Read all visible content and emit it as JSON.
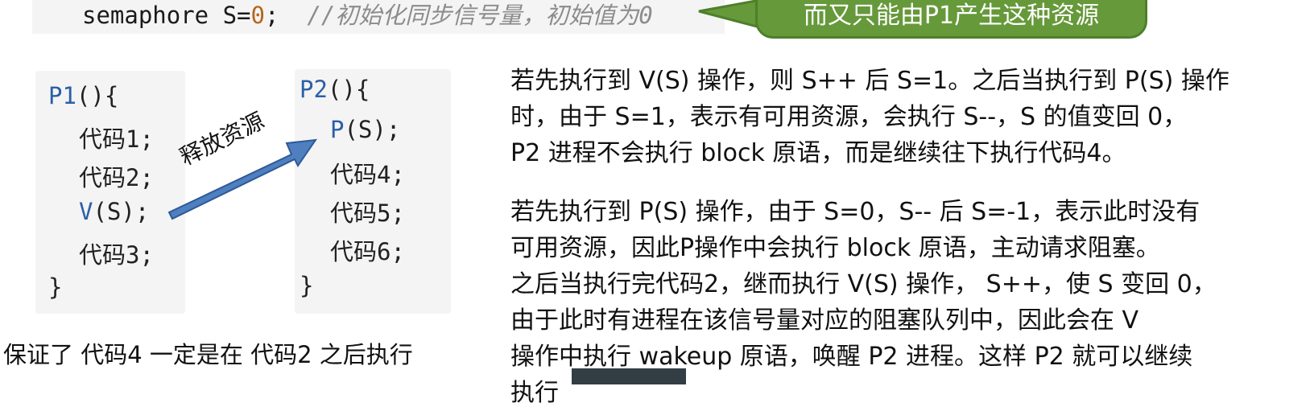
{
  "top_code": {
    "prefix": "semaphore S=",
    "number": "0",
    "suffix": ";",
    "comment": "//初始化同步信号量，初始值为0"
  },
  "callout": {
    "text": "而又只能由P1产生这种资源",
    "fill_color": "#66993a"
  },
  "p1": {
    "header_name": "P1",
    "header_rest": "(){",
    "lines": [
      "代码1;",
      "代码2;"
    ],
    "v_op": "V",
    "v_rest": "(S);",
    "last_line": "代码3;",
    "close": "}"
  },
  "p2": {
    "header_name": "P2",
    "header_rest": "(){",
    "p_op": "P",
    "p_rest": "(S);",
    "lines": [
      "代码4;",
      "代码5;",
      "代码6;"
    ],
    "close": "}"
  },
  "arrow": {
    "label": "释放资源",
    "fill_color": "#4f7fbf"
  },
  "guarantee_note": "保证了 代码4 一定是在 代码2 之后执行",
  "paragraph1": [
    "若先执行到 V(S) 操作，则 S++ 后 S=1。之后当执行到 P(S) 操作",
    "时，由于 S=1，表示有可用资源，会执行 S--，S 的值变回 0，",
    "P2 进程不会执行 block 原语，而是继续往下执行代码4。"
  ],
  "paragraph2": [
    "若先执行到 P(S) 操作，由于 S=0，S-- 后 S=-1，表示此时没有",
    "可用资源，因此P操作中会执行 block 原语，主动请求阻塞。",
    "之后当执行完代码2，继而执行 V(S) 操作， S++，使 S 变回 0，",
    "由于此时有进程在该信号量对应的阻塞队列中，因此会在 V",
    "操作中执行 wakeup 原语，唤醒 P2 进程。这样 P2 就可以继续",
    "执行"
  ]
}
